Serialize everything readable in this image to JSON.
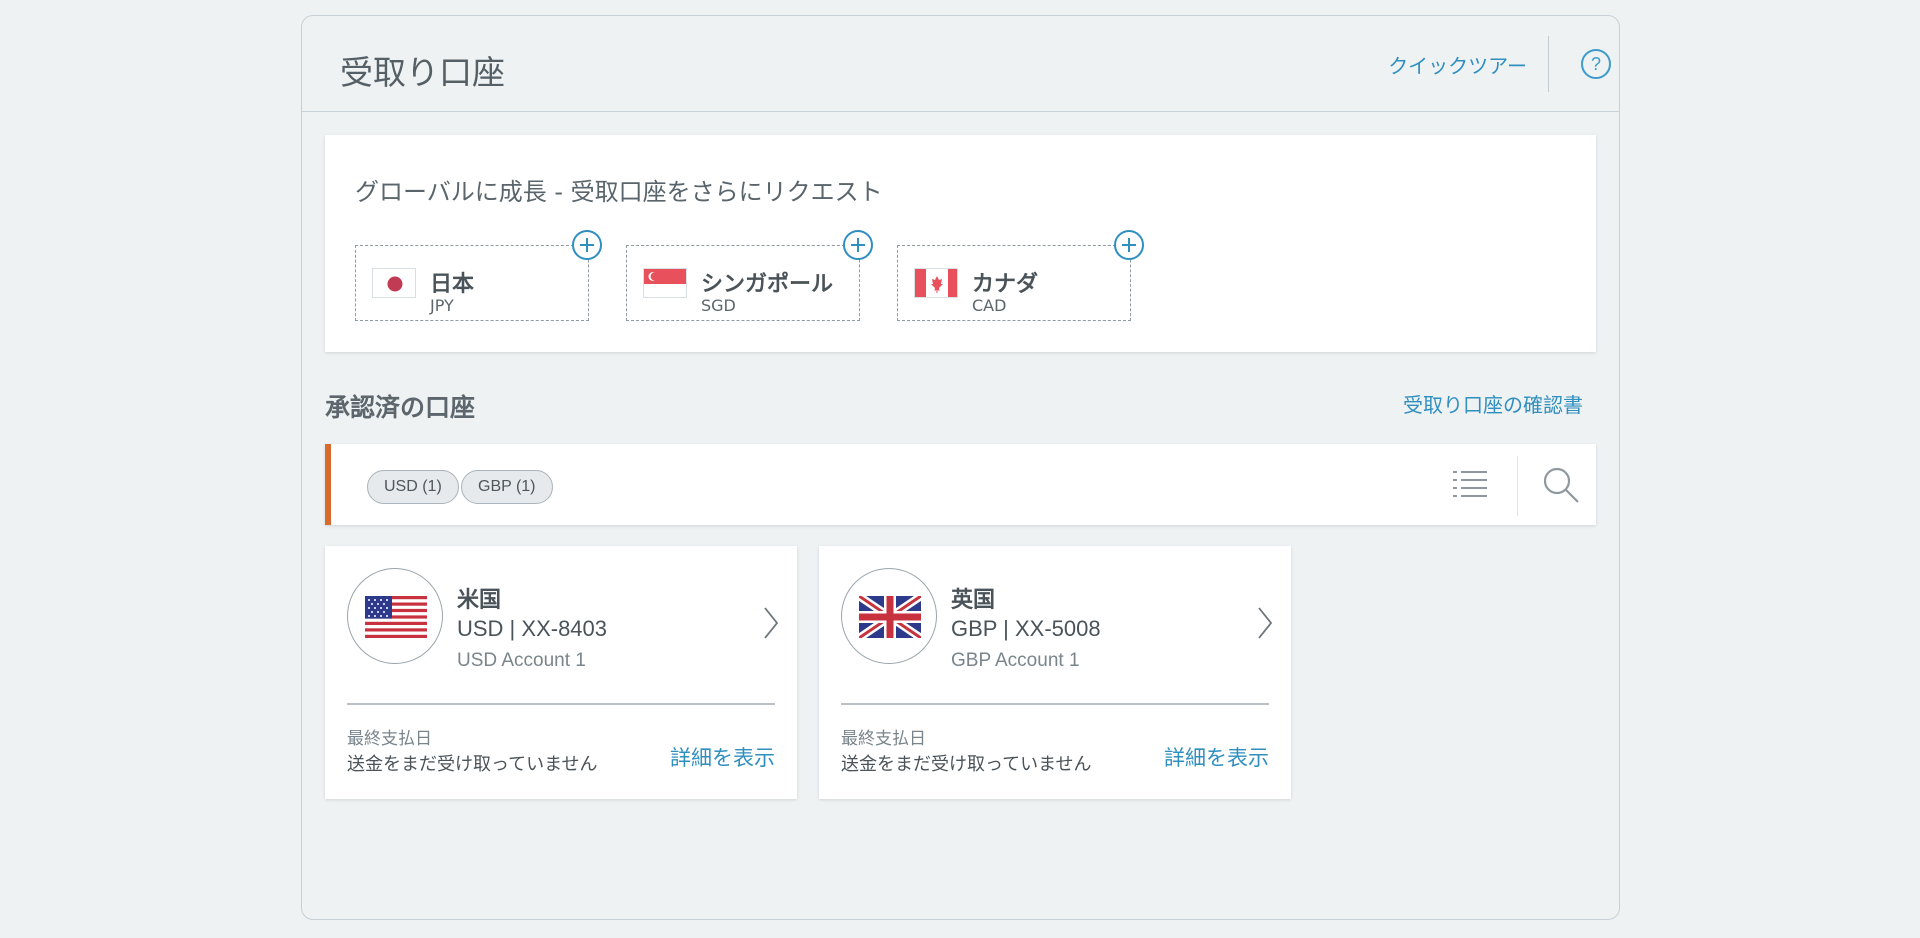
{
  "header": {
    "title": "受取り口座",
    "quick_tour": "クイックツアー",
    "help_symbol": "?"
  },
  "request": {
    "title": "グローバルに成長 - 受取口座をさらにリクエスト",
    "countries": [
      {
        "name": "日本",
        "code": "JPY",
        "flag": "japan-flag"
      },
      {
        "name": "シンガポール",
        "code": "SGD",
        "flag": "singapore-flag"
      },
      {
        "name": "カナダ",
        "code": "CAD",
        "flag": "canada-flag"
      }
    ]
  },
  "approved": {
    "title": "承認済の口座",
    "confirm_link": "受取り口座の確認書",
    "filters": [
      "USD (1)",
      "GBP (1)"
    ],
    "accounts": [
      {
        "country": "米国",
        "number": "USD | XX-8403",
        "nickname": "USD Account 1",
        "last_payment_label": "最終支払日",
        "last_payment_value": "送金をまだ受け取っていません",
        "details": "詳細を表示",
        "flag": "usa-flag"
      },
      {
        "country": "英国",
        "number": "GBP | XX-5008",
        "nickname": "GBP Account 1",
        "last_payment_label": "最終支払日",
        "last_payment_value": "送金をまだ受け取っていません",
        "details": "詳細を表示",
        "flag": "uk-flag"
      }
    ]
  },
  "colors": {
    "accent": "#2f8fbf",
    "filter_bar_border": "#d86a2b",
    "background": "#eef2f3"
  }
}
